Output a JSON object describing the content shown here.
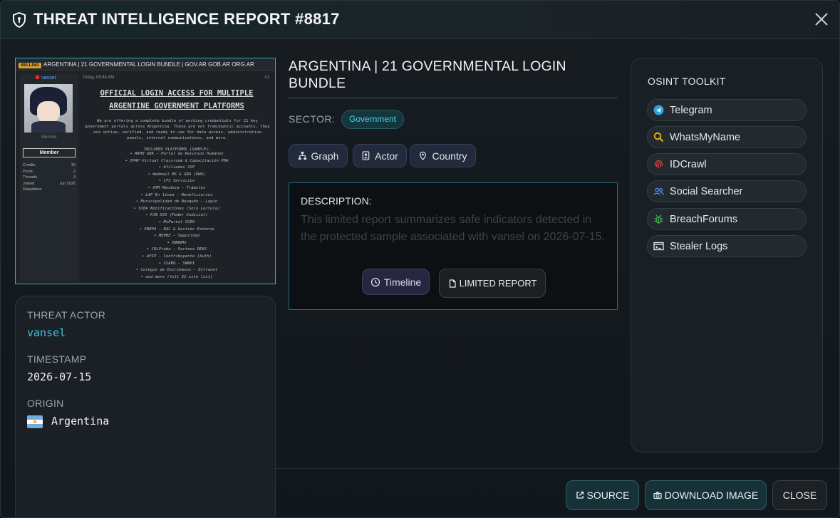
{
  "header": {
    "title": "THREAT INTELLIGENCE REPORT #8817"
  },
  "preview": {
    "topbar_tag": "SELLING",
    "topbar_title": "ARGENTINA | 21 GOVERNMENTAL LOGIN BUNDLE | GOV.AR GOB.AR ORG.AR",
    "username": "vansel",
    "rank": "Member",
    "member_label": "Member",
    "stats": [
      {
        "label": "Credits",
        "value": "30"
      },
      {
        "label": "Posts",
        "value": "2"
      },
      {
        "label": "Threads",
        "value": "3"
      },
      {
        "label": "Joined",
        "value": "Jun 2026"
      },
      {
        "label": "Reputation",
        "value": "-"
      }
    ],
    "post_time": "Today, 08:44 AM",
    "post_num": "#1",
    "headline": "OFFICIAL LOGIN ACCESS FOR MULTIPLE ARGENTINE GOVERNMENT PLATFORMS",
    "body": "We are offering a complete bundle of working credentials for 21 key government portals across Argentina. These are not free/public accounts, they are active, verified, and ready to use for data access, administrative panels, internal communications, and more.\n\nINCLUDED PLATFORMS (SAMPLE):",
    "platforms": [
      "• RRHH GBA – Portal de Recursos Humanos",
      "• IPAP Virtual Classroom & Capacitación PBA",
      "• Afiliados SSP",
      "• Webmail MS & GBA (OWA)",
      "• CFS Servicios",
      "• ATM Mendoza – Trámites",
      "• LAF En línea – Beneficiarios",
      "• Municipalidad de Neuquén – Login",
      "• SCBA Notificaciones (Solo Lectura)",
      "• PJN SSO (Poder Judicial)",
      "• MiPortal SCBA",
      "• ENRPA – RAC & Gestión Externa",
      "• MEPBE – Seguridad",
      "• ONRWMS",
      "• COLProba – Sorteos DEAS",
      "• AFIP – Contribuyente (Auth)",
      "• SIABO – SNNPI",
      "• Colegio de Escribanos – Extranet",
      "• and more (full 21-site list)"
    ]
  },
  "info": {
    "actor_label": "THREAT ACTOR",
    "actor_value": "vansel",
    "timestamp_label": "TIMESTAMP",
    "timestamp_value": "2026-07-15",
    "origin_label": "ORIGIN",
    "origin_value": "Argentina"
  },
  "report": {
    "title": "ARGENTINA | 21 GOVERNMENTAL LOGIN BUNDLE",
    "sector_label": "SECTOR:",
    "sector_value": "Government",
    "chips": {
      "graph": "Graph",
      "actor": "Actor",
      "country": "Country"
    },
    "description_label": "DESCRIPTION:",
    "description_text": "This limited report summarizes safe indicators detected in the protected sample associated with vansel on 2026-07-15.",
    "timeline_label": "Timeline",
    "limited_label": "LIMITED REPORT"
  },
  "osint": {
    "title": "OSINT TOOLKIT",
    "tools": [
      {
        "label": "Telegram",
        "icon": "telegram-icon"
      },
      {
        "label": "WhatsMyName",
        "icon": "magnifier-icon"
      },
      {
        "label": "IDCrawl",
        "icon": "fingerprint-icon"
      },
      {
        "label": "Social Searcher",
        "icon": "users-icon"
      },
      {
        "label": "BreachForums",
        "icon": "bug-icon"
      },
      {
        "label": "Stealer Logs",
        "icon": "terminal-icon"
      }
    ]
  },
  "footer": {
    "source_label": "SOURCE",
    "download_label": "DOWNLOAD IMAGE",
    "close_label": "CLOSE"
  },
  "colors": {
    "accent": "#2bb7c9",
    "actor": "#3cc6e0",
    "sector": "#47d1e6"
  }
}
